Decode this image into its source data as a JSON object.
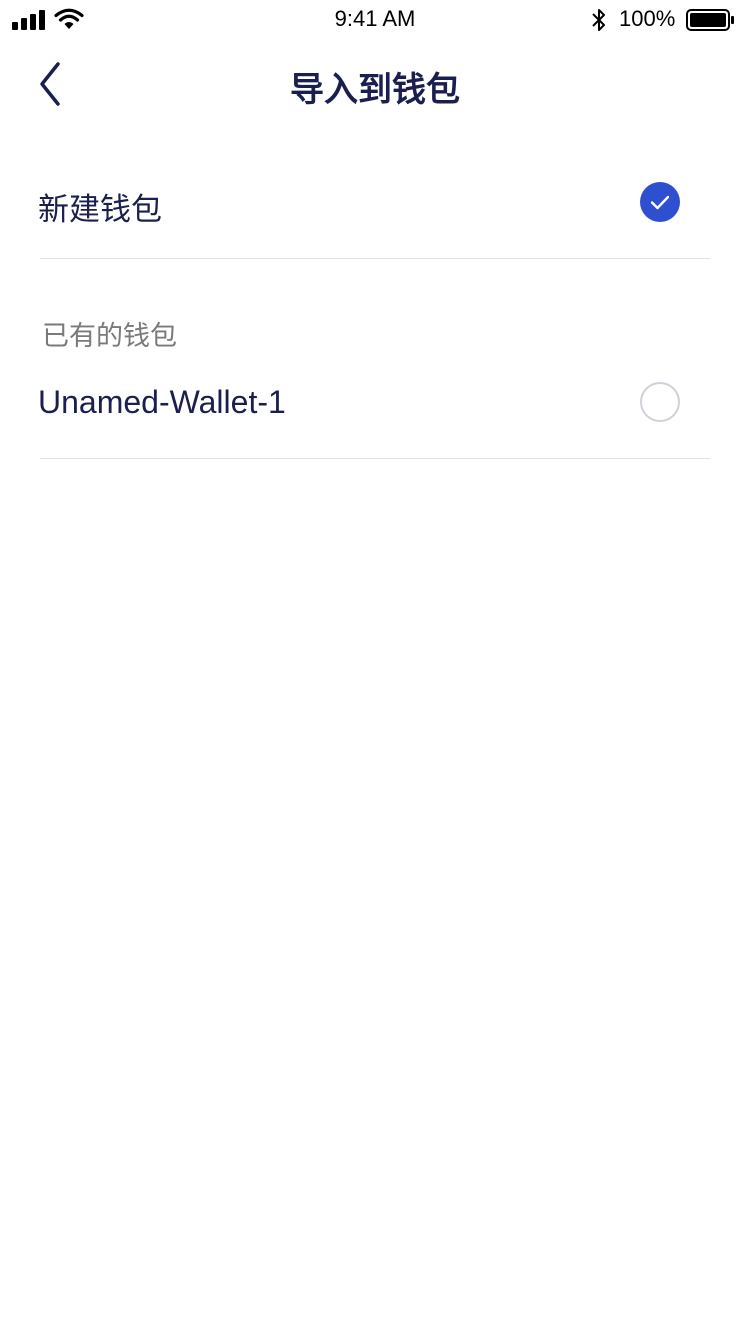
{
  "status_bar": {
    "time": "9:41 AM",
    "battery_percent": "100%",
    "battery_level": 1.0,
    "icons": [
      "signal-icon",
      "wifi-icon",
      "bluetooth-icon",
      "battery-icon"
    ]
  },
  "nav": {
    "title": "导入到钱包",
    "back_icon": "chevron-left-icon"
  },
  "new_wallet": {
    "label": "新建钱包",
    "selected": true
  },
  "existing_section": {
    "header": "已有的钱包",
    "wallets": [
      {
        "label": "Unamed-Wallet-1",
        "selected": false
      }
    ]
  },
  "colors": {
    "primary": "#2e4fcf",
    "text_dark": "#1b1f4f",
    "text_secondary": "#7a7a7a",
    "divider": "#e2e3e8"
  }
}
